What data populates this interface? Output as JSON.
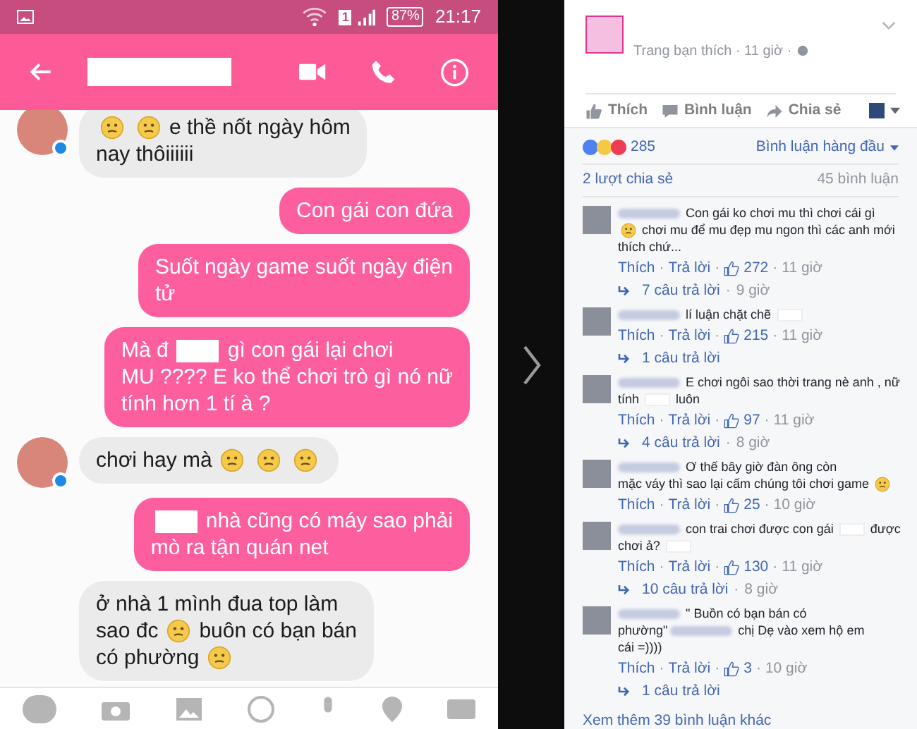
{
  "status_bar": {
    "battery": "87%",
    "signal_sim": "1",
    "time": "21:17"
  },
  "chat": {
    "messages": [
      {
        "incoming": true,
        "show_avatar": true,
        "lines": [
          [
            {
              "kind": "emoji"
            },
            {
              "kind": "emoji"
            },
            {
              "kind": "text",
              "text": "e thề nốt ngày hôm"
            }
          ],
          [
            {
              "kind": "text",
              "text": "nay thôiiiiii"
            }
          ]
        ]
      },
      {
        "incoming": false,
        "lines": [
          [
            {
              "kind": "text",
              "text": "Con gái con đứa"
            }
          ]
        ]
      },
      {
        "incoming": false,
        "lines": [
          [
            {
              "kind": "text",
              "text": "Suốt ngày game suốt ngày điện"
            }
          ],
          [
            {
              "kind": "text",
              "text": "tử"
            }
          ]
        ]
      },
      {
        "incoming": false,
        "lines": [
          [
            {
              "kind": "text",
              "text": "Mà đ"
            },
            {
              "kind": "redaction"
            },
            {
              "kind": "text",
              "text": "gì con gái lại chơi"
            }
          ],
          [
            {
              "kind": "text",
              "text": "MU ???? E ko thể chơi trò gì nó nữ"
            }
          ],
          [
            {
              "kind": "text",
              "text": "tính hơn 1 tí à ?"
            }
          ]
        ]
      },
      {
        "incoming": true,
        "show_avatar": true,
        "lines": [
          [
            {
              "kind": "text",
              "text": "chơi hay mà"
            },
            {
              "kind": "emoji"
            },
            {
              "kind": "emoji"
            },
            {
              "kind": "emoji"
            }
          ]
        ]
      },
      {
        "incoming": false,
        "lines": [
          [
            {
              "kind": "redaction"
            },
            {
              "kind": "text",
              "text": "nhà cũng có máy sao phải"
            }
          ],
          [
            {
              "kind": "text",
              "text": "mò ra tận quán net"
            }
          ]
        ]
      },
      {
        "incoming": true,
        "show_avatar": false,
        "lines": [
          [
            {
              "kind": "text",
              "text": "ở nhà 1 mình đua top làm"
            }
          ],
          [
            {
              "kind": "text",
              "text": "sao đc"
            },
            {
              "kind": "emoji"
            },
            {
              "kind": "text",
              "text": "buôn có bạn bán"
            }
          ],
          [
            {
              "kind": "text",
              "text": "có phường"
            },
            {
              "kind": "emoji"
            }
          ]
        ]
      }
    ]
  },
  "post": {
    "meta": "Trang bạn thích · 11 giờ ·",
    "actions": [
      {
        "kind": "like",
        "label": "Thích"
      },
      {
        "kind": "comment",
        "label": "Bình luận"
      },
      {
        "kind": "share",
        "label": "Chia sẻ"
      }
    ],
    "reactions_count": "285",
    "sort": "Bình luận hàng đầu",
    "shares": "2 lượt chia sẻ",
    "comments_count": "45 bình luận",
    "comments": [
      {
        "lines": [
          [
            {
              "kind": "blur"
            },
            {
              "kind": "text",
              "text": "Con gái ko chơi mu thì chơi cái gì"
            }
          ],
          [
            {
              "kind": "emoji"
            },
            {
              "kind": "text",
              "text": "chơi mu để mu đẹp mu ngon thì các anh mới"
            }
          ],
          [
            {
              "kind": "text",
              "text": "thích chứ..."
            }
          ]
        ],
        "like": "Thích",
        "reply": "Trả lời",
        "likes": "272",
        "time": "11 giờ",
        "separators": [
          "·",
          "·",
          "·"
        ],
        "replies": "7 câu trả lời",
        "replies_separator": "·",
        "replies_time": "9 giờ"
      },
      {
        "lines": [
          [
            {
              "kind": "blur"
            },
            {
              "kind": "text",
              "text": "lí luận chặt chẽ"
            },
            {
              "kind": "redaction"
            }
          ]
        ],
        "like": "Thích",
        "reply": "Trả lời",
        "likes": "215",
        "time": "11 giờ",
        "separators": [
          "·",
          "·",
          "·"
        ],
        "replies": "1 câu trả lời"
      },
      {
        "lines": [
          [
            {
              "kind": "blur"
            },
            {
              "kind": "text",
              "text": "E chơi ngôi sao thời trang nè anh , nữ"
            }
          ],
          [
            {
              "kind": "text",
              "text": "tính"
            },
            {
              "kind": "redaction"
            },
            {
              "kind": "text",
              "text": "luôn"
            }
          ]
        ],
        "like": "Thích",
        "reply": "Trả lời",
        "likes": "97",
        "time": "11 giờ",
        "separators": [
          "·",
          "·",
          "·"
        ],
        "replies": "4 câu trả lời",
        "replies_separator": "·",
        "replies_time": "8 giờ"
      },
      {
        "lines": [
          [
            {
              "kind": "blur"
            },
            {
              "kind": "text",
              "text": "Ơ thế bây giờ đàn ông còn"
            }
          ],
          [
            {
              "kind": "text",
              "text": "mặc váy thì sao lại cấm chúng tôi chơi game"
            },
            {
              "kind": "emoji"
            }
          ]
        ],
        "like": "Thích",
        "reply": "Trả lời",
        "likes": "25",
        "time": "10 giờ",
        "separators": [
          "·",
          "·",
          "·"
        ]
      },
      {
        "lines": [
          [
            {
              "kind": "blur"
            },
            {
              "kind": "text",
              "text": "con trai chơi được con gái"
            },
            {
              "kind": "redaction"
            },
            {
              "kind": "text",
              "text": "được"
            }
          ],
          [
            {
              "kind": "text",
              "text": "chơi ả?"
            },
            {
              "kind": "redaction"
            }
          ]
        ],
        "like": "Thích",
        "reply": "Trả lời",
        "likes": "130",
        "time": "11 giờ",
        "separators": [
          "·",
          "·",
          "·"
        ],
        "replies": "10 câu trả lời",
        "replies_separator": "·",
        "replies_time": "8 giờ"
      },
      {
        "lines": [
          [
            {
              "kind": "blur"
            },
            {
              "kind": "text",
              "text": "\" Buồn có bạn bán có"
            }
          ],
          [
            {
              "kind": "text",
              "text": "phường\""
            },
            {
              "kind": "blur"
            },
            {
              "kind": "text",
              "text": "chị Dẹ vào xem hộ em"
            }
          ],
          [
            {
              "kind": "text",
              "text": "cái =))))"
            }
          ]
        ],
        "like": "Thích",
        "reply": "Trả lời",
        "likes": "3",
        "time": "10 giờ",
        "separators": [
          "·",
          "·",
          "·"
        ],
        "replies": "1 câu trả lời"
      }
    ],
    "more": "Xem thêm 39 bình luận khác"
  }
}
